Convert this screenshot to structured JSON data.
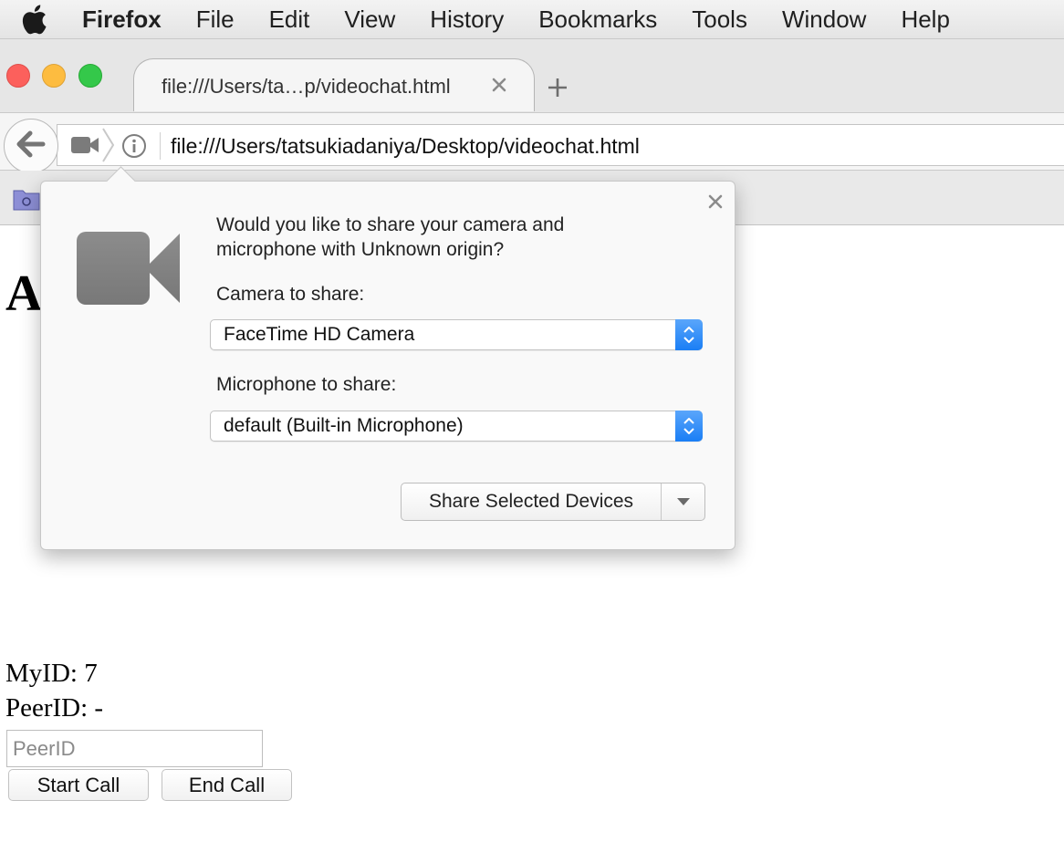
{
  "menubar": {
    "app_name": "Firefox",
    "items": [
      "File",
      "Edit",
      "View",
      "History",
      "Bookmarks",
      "Tools",
      "Window",
      "Help"
    ]
  },
  "tab": {
    "title": "file:///Users/ta…p/videochat.html"
  },
  "url": "file:///Users/tatsukiadaniya/Desktop/videochat.html",
  "page": {
    "heading": "A",
    "my_id": "MyID: 7",
    "peer_id": "PeerID: -",
    "peer_input_placeholder": "PeerID",
    "start_call_label": "Start Call",
    "end_call_label": "End Call"
  },
  "popup": {
    "question": "Would you like to share your camera and microphone with Unknown origin?",
    "camera_label": "Camera to share:",
    "camera_value": "FaceTime HD Camera",
    "microphone_label": "Microphone to share:",
    "microphone_value": "default (Built-in Microphone)",
    "share_button_label": "Share Selected Devices"
  },
  "colors": {
    "accent": "#1a7ef5",
    "traffic_close": "#fc605c",
    "traffic_minimize": "#fdbc40",
    "traffic_maximize": "#34c84a"
  },
  "icons": [
    "apple-icon",
    "camera-icon",
    "info-icon",
    "close-icon",
    "plus-icon",
    "back-arrow-icon",
    "bookmarks-folder-icon",
    "chevron-down-icon",
    "stepper-icon"
  ]
}
